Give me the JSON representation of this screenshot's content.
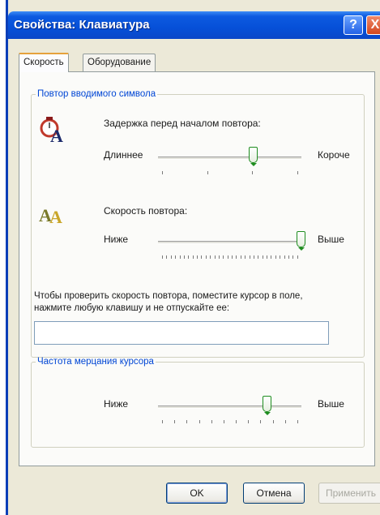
{
  "window": {
    "title": "Свойства: Клавиатура"
  },
  "titlebar_buttons": {
    "help": "?",
    "close": "X"
  },
  "tabs": [
    {
      "label": "Скорость",
      "active": true
    },
    {
      "label": "Оборудование",
      "active": false
    }
  ],
  "repeat_group": {
    "legend": "Повтор вводимого символа",
    "delay": {
      "label": "Задержка перед началом повтора:",
      "left_label": "Длиннее",
      "right_label": "Короче",
      "value_fraction": 0.67,
      "ticks": 4
    },
    "rate": {
      "label": "Скорость повтора:",
      "left_label": "Ниже",
      "right_label": "Выше",
      "value_fraction": 1.0,
      "ticks": 32
    },
    "test_hint": "Чтобы проверить скорость повтора, поместите курсор в поле, нажмите любую клавишу и не отпускайте ее:",
    "test_input_value": ""
  },
  "cursor_group": {
    "legend": "Частота мерцания курсора",
    "blink": {
      "left_label": "Ниже",
      "right_label": "Выше",
      "value_fraction": 0.75,
      "ticks": 12
    }
  },
  "buttons": {
    "ok": "OK",
    "cancel": "Отмена",
    "apply": "Применить"
  },
  "icons": {
    "delay_icon": "stopwatch-a-icon",
    "rate_icon": "double-a-icon"
  },
  "colors": {
    "titlebar": "#0650d8",
    "legend_text": "#0046d5",
    "slider_thumb": "#1f8d20"
  }
}
